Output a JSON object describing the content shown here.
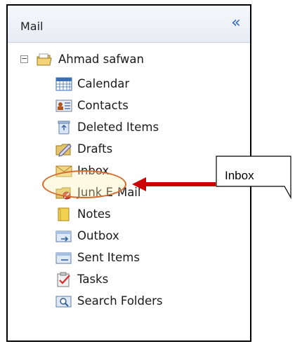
{
  "pane": {
    "title": "Mail",
    "collapse_glyph": "«"
  },
  "tree": {
    "root": {
      "label": "Ahmad safwan",
      "expander": "−",
      "icon": "personal-folders-icon"
    },
    "items": [
      {
        "label": "Calendar",
        "icon": "calendar-icon"
      },
      {
        "label": "Contacts",
        "icon": "contacts-icon"
      },
      {
        "label": "Deleted Items",
        "icon": "deleted-items-icon"
      },
      {
        "label": "Drafts",
        "icon": "drafts-icon"
      },
      {
        "label": "Inbox",
        "icon": "inbox-icon",
        "highlighted": true
      },
      {
        "label": "Junk E-Mail",
        "icon": "junk-email-icon"
      },
      {
        "label": "Notes",
        "icon": "notes-icon"
      },
      {
        "label": "Outbox",
        "icon": "outbox-icon"
      },
      {
        "label": "Sent Items",
        "icon": "sent-items-icon"
      },
      {
        "label": "Tasks",
        "icon": "tasks-icon"
      },
      {
        "label": "Search Folders",
        "icon": "search-folders-icon"
      }
    ]
  },
  "callout": {
    "label": "Inbox"
  },
  "colors": {
    "arrow": "#cc0000",
    "highlight_ring": "#d66a2c",
    "collapse_accent": "#2a64c2"
  }
}
